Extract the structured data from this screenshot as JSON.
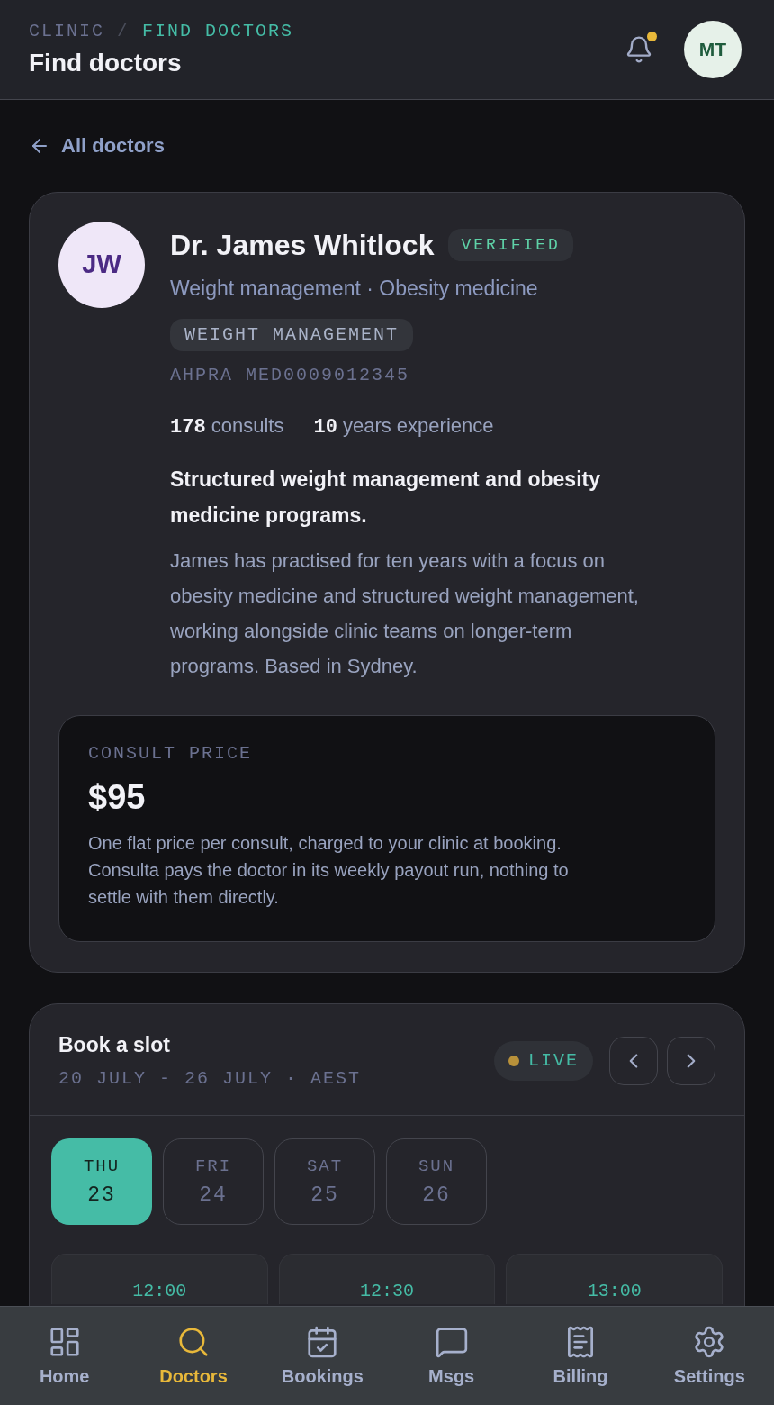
{
  "header": {
    "breadcrumb": [
      {
        "label": "CLINIC",
        "current": false
      },
      {
        "label": "FIND DOCTORS",
        "current": true
      }
    ],
    "separator": "/",
    "title": "Find doctors",
    "notifications": {
      "unread": true
    },
    "avatar": {
      "initials": "MT"
    }
  },
  "back_link": {
    "label": "All doctors"
  },
  "doctor": {
    "initials": "JW",
    "name": "Dr. James Whitlock",
    "badge": "VERIFIED",
    "specialties": "Weight management · Obesity medicine",
    "tag": "WEIGHT MANAGEMENT",
    "registration": "AHPRA MED0009012345",
    "stats": [
      {
        "text": "**178** consults"
      },
      {
        "text": "**10** years experience"
      }
    ],
    "headline": "Structured weight management and obesity medicine programs.",
    "bio": "James has practised for ten years with a focus on obesity medicine and structured weight management, working alongside clinic teams on longer-term programs. Based in Sydney."
  },
  "price": {
    "label": "CONSULT PRICE",
    "amount": "$95",
    "note": "One flat price per consult, charged to your clinic at booking. Consulta pays the doctor in its weekly payout run, nothing to settle with them directly."
  },
  "booking": {
    "title": "Book a slot",
    "range": "20 JULY - 26 JULY · AEST",
    "status": "LIVE",
    "days": [
      {
        "weekday": "THU",
        "date": "23",
        "selected": true
      },
      {
        "weekday": "FRI",
        "date": "24",
        "selected": false
      },
      {
        "weekday": "SAT",
        "date": "25",
        "selected": false
      },
      {
        "weekday": "SUN",
        "date": "26",
        "selected": false
      }
    ],
    "slots": [
      {
        "time": "12:00"
      },
      {
        "time": "12:30"
      },
      {
        "time": "13:00"
      }
    ]
  },
  "nav": [
    {
      "label": "Home",
      "kind": "home",
      "selected": false
    },
    {
      "label": "Doctors",
      "kind": "doctors",
      "selected": true
    },
    {
      "label": "Bookings",
      "kind": "bookings",
      "selected": false
    },
    {
      "label": "Msgs",
      "kind": "messages",
      "selected": false
    },
    {
      "label": "Billing",
      "kind": "billing",
      "selected": false
    },
    {
      "label": "Settings",
      "kind": "settings",
      "selected": false
    }
  ]
}
